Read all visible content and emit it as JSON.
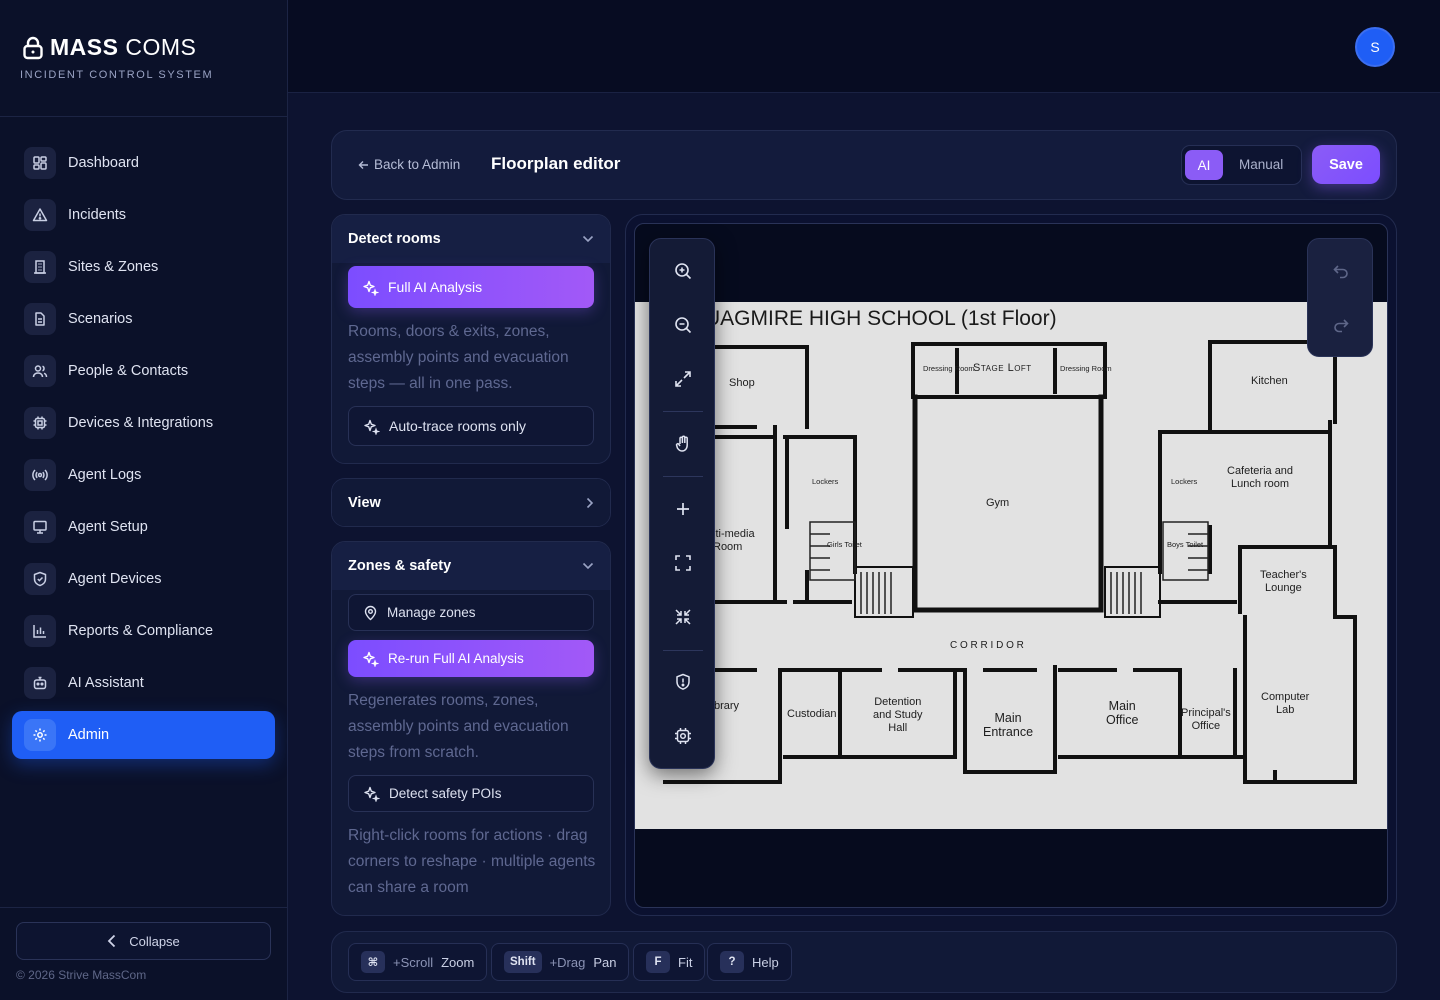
{
  "brand": {
    "name_bold": "MASS",
    "name_light": "COMS",
    "subtitle": "INCIDENT CONTROL SYSTEM"
  },
  "user": {
    "avatar_initial": "S"
  },
  "nav": {
    "items": [
      {
        "label": "Dashboard",
        "icon": "grid-icon",
        "active": false
      },
      {
        "label": "Incidents",
        "icon": "warning-icon",
        "active": false
      },
      {
        "label": "Sites & Zones",
        "icon": "building-icon",
        "active": false
      },
      {
        "label": "Scenarios",
        "icon": "document-icon",
        "active": false
      },
      {
        "label": "People & Contacts",
        "icon": "people-icon",
        "active": false
      },
      {
        "label": "Devices & Integrations",
        "icon": "chip-icon",
        "active": false
      },
      {
        "label": "Agent Logs",
        "icon": "broadcast-icon",
        "active": false
      },
      {
        "label": "Agent Setup",
        "icon": "monitor-icon",
        "active": false
      },
      {
        "label": "Agent Devices",
        "icon": "shield-check-icon",
        "active": false
      },
      {
        "label": "Reports & Compliance",
        "icon": "bar-chart-icon",
        "active": false
      },
      {
        "label": "AI Assistant",
        "icon": "robot-icon",
        "active": false
      },
      {
        "label": "Admin",
        "icon": "gear-icon",
        "active": true
      }
    ],
    "collapse_label": "Collapse",
    "copyright": "© 2026 Strive MassCom"
  },
  "editor": {
    "back_label": "Back to Admin",
    "title": "Floorplan editor",
    "mode_ai": "AI",
    "mode_manual": "Manual",
    "active_mode": "AI",
    "save_label": "Save"
  },
  "panels": {
    "detect_rooms": {
      "title": "Detect rooms",
      "expanded": true,
      "primary_label": "Full AI Analysis",
      "description": "Rooms, doors & exits, zones, assembly points and evacuation steps — all in one pass.",
      "secondary_label": "Auto-trace rooms only"
    },
    "view": {
      "title": "View",
      "expanded": false
    },
    "zones_safety": {
      "title": "Zones & safety",
      "expanded": true,
      "manage_label": "Manage zones",
      "rerun_label": "Re-run Full AI Analysis",
      "rerun_description": "Regenerates rooms, zones, assembly points and evacuation steps from scratch.",
      "detect_pois_label": "Detect safety POIs",
      "hint": "Right-click rooms for actions · drag corners to reshape · multiple agents can share a room"
    }
  },
  "floorplan": {
    "title": "UAGMIRE HIGH SCHOOL (1st Floor)",
    "rooms": {
      "shop": "Shop",
      "stage_loft": "Stage Loft",
      "dressing_left": "Dressing Room",
      "dressing_right": "Dressing Room",
      "kitchen": "Kitchen",
      "lockers_left": "Lockers",
      "lockers_right": "Lockers",
      "gym": "Gym",
      "cafeteria": "Cafeteria and\nLunch room",
      "multimedia": "lti-media\nRoom",
      "girls_toilet": "Girls Toilet",
      "boys_toilet": "Boys Toilet",
      "teachers_lounge": "Teacher's\nLounge",
      "corridor": "C O R R I D O R",
      "library": "brary",
      "custodian": "Custodian",
      "detention": "Detention\nand Study\nHall",
      "main_entrance": "Main\nEntrance",
      "main_office": "Main\nOffice",
      "principals_office": "Principal's\nOffice",
      "computer_lab": "Computer\nLab"
    }
  },
  "toolbar": {
    "tools": [
      "zoom-in-icon",
      "zoom-out-icon",
      "expand-icon",
      "hand-icon",
      "plus-icon",
      "fit-frame-icon",
      "collapse-arrows-icon",
      "shield-alert-icon",
      "settings-chip-icon"
    ]
  },
  "history": {
    "undo_icon": "undo-icon",
    "redo_icon": "redo-icon"
  },
  "shortcuts": [
    {
      "key": "⌘",
      "modifier": "+Scroll",
      "action": "Zoom"
    },
    {
      "key": "Shift",
      "modifier": "+Drag",
      "action": "Pan"
    },
    {
      "key": "F",
      "modifier": "",
      "action": "Fit"
    },
    {
      "key": "?",
      "modifier": "",
      "action": "Help"
    }
  ],
  "colors": {
    "accent_blue": "#1f5ef5",
    "accent_purple": "#8b5cf6",
    "background": "#0a1028"
  }
}
